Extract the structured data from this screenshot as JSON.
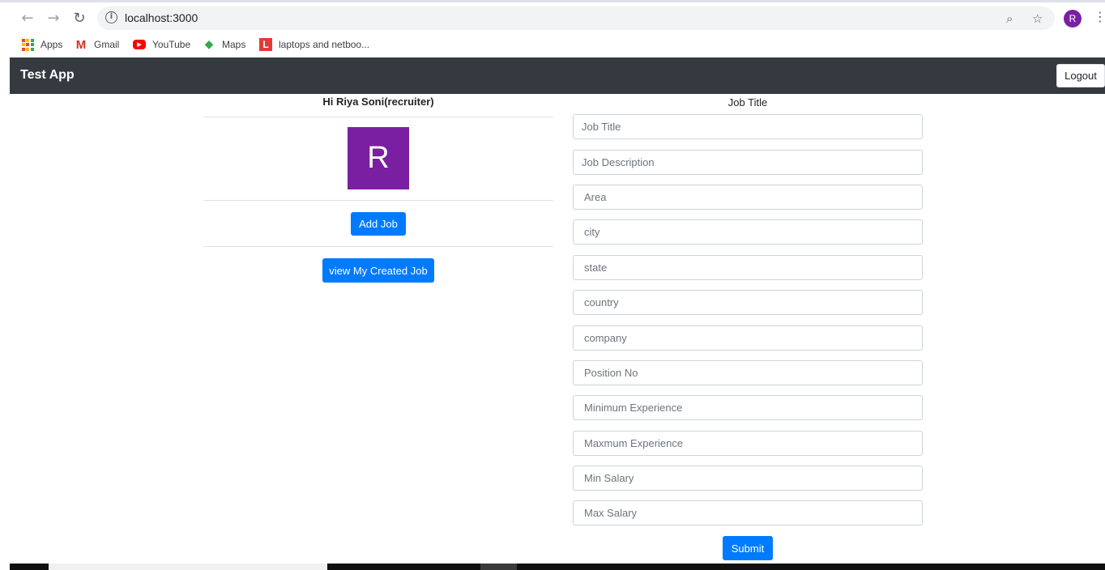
{
  "browser": {
    "url": "localhost:3000",
    "profile_initial": "R",
    "bookmarks": [
      {
        "label": "Apps"
      },
      {
        "label": "Gmail"
      },
      {
        "label": "YouTube"
      },
      {
        "label": "Maps"
      },
      {
        "label": "laptops and netboo..."
      }
    ]
  },
  "navbar": {
    "brand": "Test App",
    "logout_label": "Logout"
  },
  "profile_panel": {
    "greeting": "Hi Riya Soni(recruiter)",
    "avatar_letter": "R",
    "avatar_color": "#7b1fa2",
    "add_job_label": "Add Job",
    "view_jobs_label": "view My Created Job"
  },
  "job_form": {
    "title": "Job Title",
    "fields": [
      {
        "placeholder": "Job Title"
      },
      {
        "placeholder": "Job Description"
      },
      {
        "placeholder": "Area"
      },
      {
        "placeholder": "city"
      },
      {
        "placeholder": "state"
      },
      {
        "placeholder": "country"
      },
      {
        "placeholder": "company"
      },
      {
        "placeholder": "Position No"
      },
      {
        "placeholder": "Minimum Experience"
      },
      {
        "placeholder": "Maxmum Experience"
      },
      {
        "placeholder": "Min Salary"
      },
      {
        "placeholder": "Max Salary"
      }
    ],
    "submit_label": "Submit"
  },
  "colors": {
    "navbar": "#343a40",
    "primary": "#007bff"
  }
}
